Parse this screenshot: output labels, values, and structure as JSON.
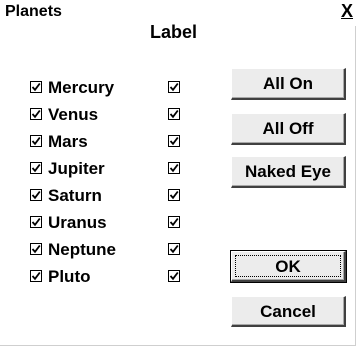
{
  "window": {
    "title": "Planets",
    "close_label": "X"
  },
  "column_header": "Label",
  "planets": [
    {
      "name": "Mercury",
      "checked": true,
      "label_checked": true
    },
    {
      "name": "Venus",
      "checked": true,
      "label_checked": true
    },
    {
      "name": "Mars",
      "checked": true,
      "label_checked": true
    },
    {
      "name": "Jupiter",
      "checked": true,
      "label_checked": true
    },
    {
      "name": "Saturn",
      "checked": true,
      "label_checked": true
    },
    {
      "name": "Uranus",
      "checked": true,
      "label_checked": true
    },
    {
      "name": "Neptune",
      "checked": true,
      "label_checked": true
    },
    {
      "name": "Pluto",
      "checked": true,
      "label_checked": true
    }
  ],
  "buttons": {
    "all_on": "All On",
    "all_off": "All Off",
    "naked_eye": "Naked Eye",
    "ok": "OK",
    "cancel": "Cancel"
  }
}
